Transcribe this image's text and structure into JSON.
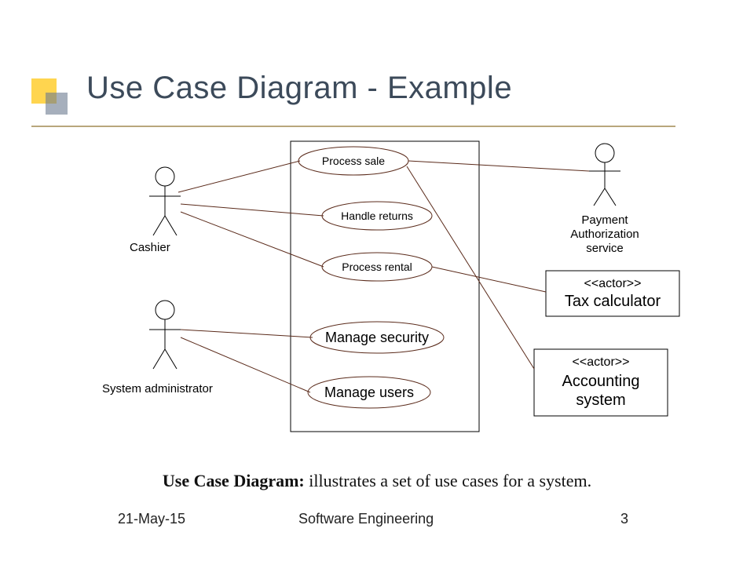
{
  "title": "Use Case Diagram - Example",
  "caption_bold": "Use Case Diagram:",
  "caption_rest": " illustrates a set of use cases for a system.",
  "footer": {
    "date": "21-May-15",
    "course": "Software Engineering",
    "page": "3"
  },
  "actors": {
    "cashier": "Cashier",
    "sysadmin": "System administrator",
    "payment": {
      "l1": "Payment",
      "l2": "Authorization",
      "l3": "service"
    }
  },
  "usecases": {
    "process_sale": "Process sale",
    "handle_returns": "Handle returns",
    "process_rental": "Process rental",
    "manage_security": "Manage security",
    "manage_users": "Manage users"
  },
  "actor_boxes": {
    "tax": {
      "stereo": "<<actor>>",
      "name": "Tax calculator"
    },
    "acct": {
      "stereo": "<<actor>>",
      "l1": "Accounting",
      "l2": "system"
    }
  }
}
